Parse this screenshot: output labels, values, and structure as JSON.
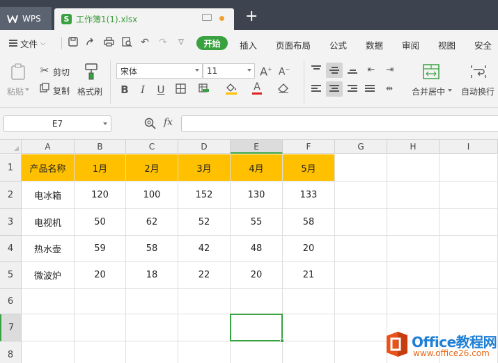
{
  "titlebar": {
    "app_tab": "WPS",
    "doc_tab": "工作簿1(1).xlsx",
    "sheet_badge": "S",
    "new_tab": "+"
  },
  "menubar": {
    "file": "文件",
    "start": "开始",
    "tabs": [
      "插入",
      "页面布局",
      "公式",
      "数据",
      "审阅",
      "视图",
      "安全"
    ]
  },
  "ribbon": {
    "paste": "粘贴",
    "cut": "剪切",
    "copy": "复制",
    "format_painter": "格式刷",
    "font_name": "宋体",
    "font_size": "11",
    "bold": "B",
    "italic": "I",
    "underline": "U",
    "merge_center": "合并居中",
    "wrap_text": "自动换行"
  },
  "formula_bar": {
    "name_box": "E7",
    "fx": "fx",
    "formula": ""
  },
  "sheet": {
    "columns": [
      "A",
      "B",
      "C",
      "D",
      "E",
      "F",
      "G",
      "H",
      "I"
    ],
    "rows": [
      "1",
      "2",
      "3",
      "4",
      "5",
      "6",
      "7",
      "8"
    ],
    "header_row": [
      "产品名称",
      "1月",
      "2月",
      "3月",
      "4月",
      "5月"
    ],
    "data_rows": [
      [
        "电冰箱",
        "120",
        "100",
        "152",
        "130",
        "133"
      ],
      [
        "电视机",
        "50",
        "62",
        "52",
        "55",
        "58"
      ],
      [
        "热水壶",
        "59",
        "58",
        "42",
        "48",
        "20"
      ],
      [
        "微波炉",
        "20",
        "18",
        "22",
        "20",
        "21"
      ]
    ],
    "selected_cell": "E7",
    "header_fill": "#ffc000",
    "selection_color": "#3aa141"
  },
  "watermark": {
    "brand": "Office教程网",
    "url": "www.office26.com"
  }
}
